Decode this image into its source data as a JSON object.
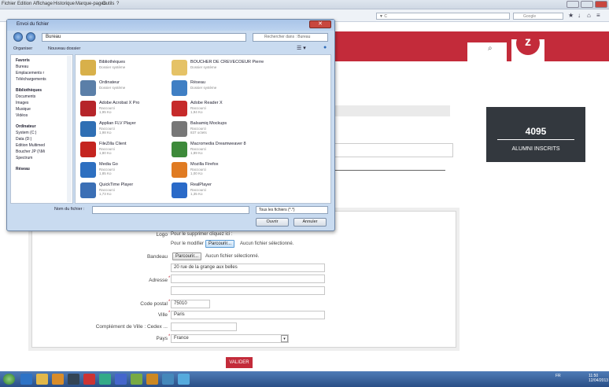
{
  "browser": {
    "menu": [
      "Fichier",
      "Edition",
      "Affichage",
      "Historique",
      "Marque-pages",
      "Outils",
      "?"
    ],
    "url_placeholder": "▼ C",
    "search_label": "Google"
  },
  "dialog": {
    "title": "Envoi du fichier",
    "address": "Bureau",
    "search_placeholder": "Rechercher dans : Bureau",
    "toolbar": {
      "organize": "Organiser",
      "new_folder": "Nouveau dossier"
    },
    "nav": [
      "Favoris",
      "Bureau",
      "Emplacements r",
      "Téléchargements",
      "Bibliothèques",
      "Documents",
      "Images",
      "Musique",
      "Vidéos",
      "Ordinateur",
      "System (C:)",
      "Data (D:)",
      "Edition Multimed",
      "Boucher JP (\\\\Mi",
      "Spectrum",
      "Réseau"
    ],
    "files": [
      {
        "name": "Bibliothèques",
        "sub": "Dossier système",
        "color": "#d8b04a"
      },
      {
        "name": "BOUCHER DE CREVECOEUR Pierre",
        "sub": "Dossier système",
        "color": "#e5c266"
      },
      {
        "name": "Ordinateur",
        "sub": "Dossier système",
        "color": "#5b7fa8"
      },
      {
        "name": "Réseau",
        "sub": "Dossier système",
        "color": "#3f7fc4"
      },
      {
        "name": "Adobe Acrobat X Pro",
        "sub": "Raccourci\n1,95 Ko",
        "color": "#b6252a"
      },
      {
        "name": "Adobe Reader X",
        "sub": "Raccourci\n1,94 Ko",
        "color": "#c62a2a"
      },
      {
        "name": "Applian FLV Player",
        "sub": "Raccourci\n1,98 Ko",
        "color": "#2f6fb4"
      },
      {
        "name": "Balsamiq Mockups",
        "sub": "Raccourci\n837 octets",
        "color": "#777777"
      },
      {
        "name": "FileZilla Client",
        "sub": "Raccourci\n1,80 Ko",
        "color": "#c4241f"
      },
      {
        "name": "Macromedia Dreamweaver 8",
        "sub": "Raccourci\n1,89 Ko",
        "color": "#3d8a3a"
      },
      {
        "name": "Media Go",
        "sub": "Raccourci\n1,85 Ko",
        "color": "#2d6fc0"
      },
      {
        "name": "Mozilla Firefox",
        "sub": "Raccourci\n1,00 Ko",
        "color": "#e07b22"
      },
      {
        "name": "QuickTime Player",
        "sub": "Raccourci\n1,73 Ko",
        "color": "#3b6fb5"
      },
      {
        "name": "RealPlayer",
        "sub": "Raccourci\n1,35 Ko",
        "color": "#2a6ac8"
      }
    ],
    "filename_label": "Nom du fichier :",
    "filetype": "Tous les fichiers (*.*)",
    "open_button": "Ouvrir",
    "cancel_button": "Annuler"
  },
  "stats": {
    "count": "4095",
    "label": "ALUMNI INSCRITS"
  },
  "form": {
    "logo_label": "Logo",
    "logo_delete": "Pour le supprimer cliquez ici :",
    "logo_modify": "Pour le modifier :",
    "browse": "Parcourir...",
    "no_file": "Aucun fichier sélectionné.",
    "banner_label": "Bandeau",
    "address_label": "Adresse",
    "address_value": "20 rue de la grange aux belles",
    "zip_label": "Code postal",
    "zip_value": "75010",
    "city_label": "Ville",
    "city_value": "Paris",
    "city_extra_label": "Complément de Ville : Cedex ...",
    "country_label": "Pays",
    "country_value": "France",
    "submit": "VALIDER"
  },
  "taskbar": {
    "tray": "FR",
    "time": "11:50",
    "date": "12/04/2013"
  }
}
